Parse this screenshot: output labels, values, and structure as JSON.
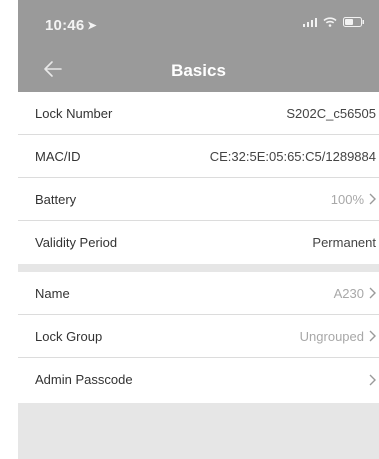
{
  "status_bar": {
    "time": "10:46",
    "location_icon": "location-arrow-icon",
    "signal_icon": "signal-icon",
    "wifi_icon": "wifi-icon",
    "battery_icon": "battery-icon"
  },
  "nav": {
    "back_icon": "back-arrow-icon",
    "title": "Basics"
  },
  "lock_info": [
    {
      "label": "Lock Number",
      "value": "S202C_c56505",
      "chevron": false
    },
    {
      "label": "MAC/ID",
      "value": "CE:32:5E:05:65:C5/1289884",
      "chevron": false
    },
    {
      "label": "Battery",
      "value": "100%",
      "chevron": true
    },
    {
      "label": "Validity Period",
      "value": "Permanent",
      "chevron": false
    }
  ],
  "settings": [
    {
      "label": "Name",
      "value": "A230",
      "chevron": true
    },
    {
      "label": "Lock Group",
      "value": "Ungrouped",
      "chevron": true
    },
    {
      "label": "Admin Passcode",
      "value": "",
      "chevron": true
    }
  ],
  "colors": {
    "header_bg": "#9a9a9a",
    "page_bg": "#e6e6e6",
    "row_bg": "#ffffff",
    "muted_text": "#a8a8a8"
  }
}
